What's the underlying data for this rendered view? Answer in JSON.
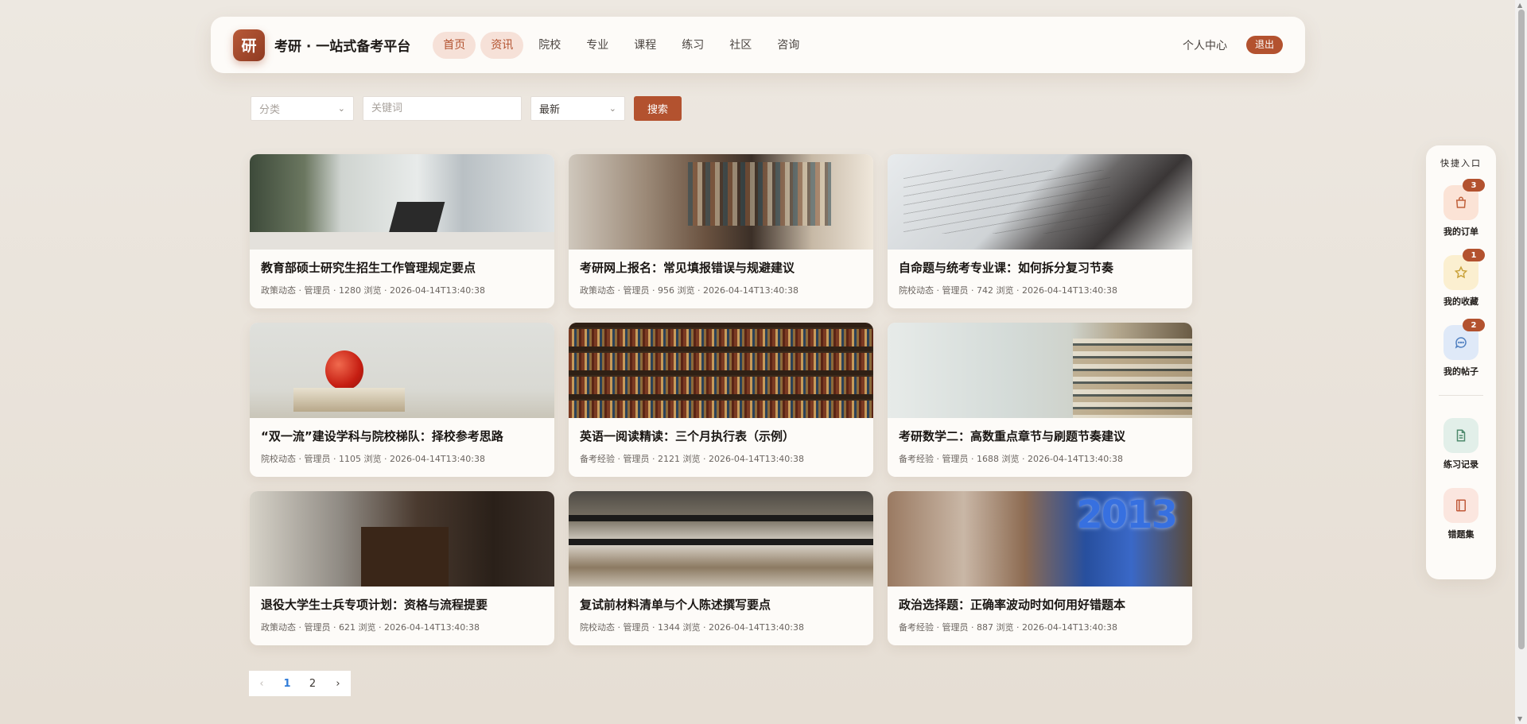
{
  "header": {
    "logo_char": "研",
    "brand": "考研 · 一站式备考平台",
    "nav": [
      {
        "label": "首页",
        "active": true
      },
      {
        "label": "资讯",
        "active": true
      },
      {
        "label": "院校",
        "active": false
      },
      {
        "label": "专业",
        "active": false
      },
      {
        "label": "课程",
        "active": false
      },
      {
        "label": "练习",
        "active": false
      },
      {
        "label": "社区",
        "active": false
      },
      {
        "label": "咨询",
        "active": false
      }
    ],
    "user_center": "个人中心",
    "logout": "退出"
  },
  "filters": {
    "category_placeholder": "分类",
    "keyword_placeholder": "关键词",
    "sort_value": "最新",
    "search_label": "搜索"
  },
  "articles": [
    {
      "title": "教育部硕士研究生招生工作管理规定要点",
      "meta": "政策动态 · 管理员 · 1280 浏览 · 2026-04-14T13:40:38"
    },
    {
      "title": "考研网上报名：常见填报错误与规避建议",
      "meta": "政策动态 · 管理员 · 956 浏览 · 2026-04-14T13:40:38"
    },
    {
      "title": "自命题与统考专业课：如何拆分复习节奏",
      "meta": "院校动态 · 管理员 · 742 浏览 · 2026-04-14T13:40:38"
    },
    {
      "title": "“双一流”建设学科与院校梯队：择校参考思路",
      "meta": "院校动态 · 管理员 · 1105 浏览 · 2026-04-14T13:40:38"
    },
    {
      "title": "英语一阅读精读：三个月执行表（示例）",
      "meta": "备考经验 · 管理员 · 2121 浏览 · 2026-04-14T13:40:38"
    },
    {
      "title": "考研数学二：高数重点章节与刷题节奏建议",
      "meta": "备考经验 · 管理员 · 1688 浏览 · 2026-04-14T13:40:38"
    },
    {
      "title": "退役大学生士兵专项计划：资格与流程提要",
      "meta": "政策动态 · 管理员 · 621 浏览 · 2026-04-14T13:40:38"
    },
    {
      "title": "复试前材料清单与个人陈述撰写要点",
      "meta": "院校动态 · 管理员 · 1344 浏览 · 2026-04-14T13:40:38"
    },
    {
      "title": "政治选择题：正确率波动时如何用好错题本",
      "meta": "备考经验 · 管理员 · 887 浏览 · 2026-04-14T13:40:38"
    }
  ],
  "pagination": {
    "prev": "‹",
    "pages": [
      "1",
      "2"
    ],
    "current": "1",
    "next": "›"
  },
  "quick_access": {
    "title": "快捷入口",
    "items": [
      {
        "label": "我的订单",
        "badge": "3",
        "icon": "shopping-bag-icon",
        "bg": "#fbe3d6",
        "color": "#c0603a"
      },
      {
        "label": "我的收藏",
        "badge": "1",
        "icon": "star-icon",
        "bg": "#fbefd0",
        "color": "#c9a23a"
      },
      {
        "label": "我的帖子",
        "badge": "2",
        "icon": "chat-icon",
        "bg": "#dfe9f8",
        "color": "#4f7fc0"
      },
      {
        "label": "练习记录",
        "badge": "",
        "icon": "document-icon",
        "bg": "#e2efe9",
        "color": "#4f8a6d"
      },
      {
        "label": "错题集",
        "badge": "",
        "icon": "notebook-icon",
        "bg": "#fbe6df",
        "color": "#c05a3a"
      }
    ]
  },
  "colors": {
    "accent": "#b3522f",
    "background": "#ebe5de",
    "active_nav_bg": "#f6e1d8",
    "pager_active": "#2f7bd8"
  }
}
